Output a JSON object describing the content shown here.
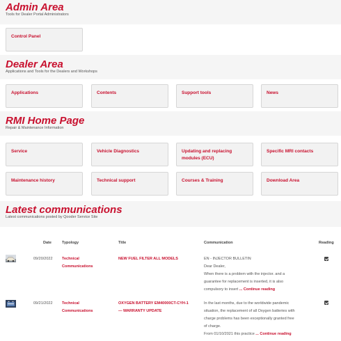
{
  "sections": {
    "admin": {
      "title": "Admin Area",
      "subtitle": "Tools for Dealer Portal Administrators",
      "cards": [
        "Control Panel"
      ]
    },
    "dealer": {
      "title": "Dealer Area",
      "subtitle": "Applications and Tools for the Dealers and Workshops",
      "cards": [
        "Applications",
        "Contents",
        "Support tools",
        "News"
      ]
    },
    "rmi": {
      "title": "RMI Home Page",
      "subtitle": "Repair & Maintenance Information",
      "cards": [
        "Service",
        "Vehicle Diagnostics",
        "Updating and replacing modules (ECU)",
        "Specific MRI contacts",
        "Maintenance history",
        "Technical support",
        "Courses & Training",
        "Download Area"
      ]
    },
    "latest": {
      "title": "Latest communications",
      "subtitle": "Latest communications posted by Qooder Service Site"
    }
  },
  "table": {
    "headers": [
      "Date",
      "Typology",
      "Title",
      "Communication",
      "Reading"
    ],
    "rows": [
      {
        "date": "09/20/2022",
        "typology": [
          "Technical",
          "Communications"
        ],
        "title": [
          "NEW FUEL FILTER ALL MODELS"
        ],
        "communication": [
          "EN - INJECTOR BULLETIN",
          "Dear Dealer,",
          "When there is a problem with the injector. and a",
          "guarantee for replacement is inserted, it is also"
        ],
        "last_line": "compulsory to insert",
        "read_more": "... Continue reading",
        "thumb_icon": "car-icon",
        "read": true
      },
      {
        "date": "09/21/2022",
        "typology": [
          "Technical",
          "Communications"
        ],
        "title": [
          "OXYGEN BATTERY EM40000CT-CYH-1",
          "— WARRANTY UPDATE"
        ],
        "communication": [
          "In the last months, due to the worldwide pandemic",
          "situation, the replacement of all Oxygen batteries with",
          "charge problems has been exceptionally granted free",
          "of charge."
        ],
        "last_line": "From 01/10/2021 this practice",
        "read_more": "... Continue reading",
        "thumb_icon": "battery-icon",
        "read": true
      }
    ]
  },
  "colors": {
    "accent": "#c8102e",
    "card_bg": "#f2f2f2",
    "band_bg": "#f5f5f5"
  }
}
